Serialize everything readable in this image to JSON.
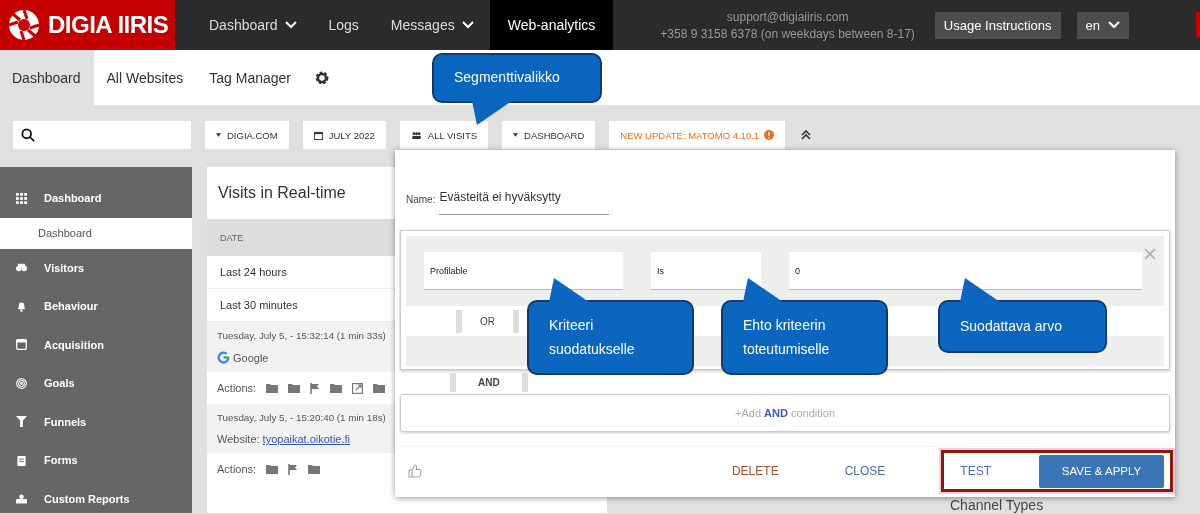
{
  "header": {
    "logo": "DIGIA IIRIS",
    "nav": [
      {
        "label": "Dashboard",
        "dropdown": true,
        "selected": false
      },
      {
        "label": "Logs",
        "dropdown": false,
        "selected": false
      },
      {
        "label": "Messages",
        "dropdown": true,
        "selected": false
      },
      {
        "label": "Web-analytics",
        "dropdown": false,
        "selected": true
      }
    ],
    "support_email": "support@digiaiiris.com",
    "support_phone": "+358 9 3158 6378 (on weekdays between 8-17)",
    "usage_button": "Usage Instructions",
    "language": "en"
  },
  "tabs": [
    {
      "label": "Dashboard",
      "selected": true
    },
    {
      "label": "All Websites",
      "selected": false
    },
    {
      "label": "Tag Manager",
      "selected": false
    }
  ],
  "toolbar": {
    "selectors": [
      {
        "kind": "dropdown",
        "label": "DIGIA.COM"
      },
      {
        "kind": "calendar",
        "label": "JULY 2022"
      },
      {
        "kind": "segment",
        "label": "ALL VISITS"
      },
      {
        "kind": "dropdown",
        "label": "DASHBOARD"
      }
    ],
    "update_notice": "NEW UPDATE: MATOMO 4.10.1"
  },
  "sidebar": [
    {
      "label": "Dashboard",
      "kind": "grid",
      "children": [
        {
          "label": "Dashboard",
          "selected": true
        }
      ]
    },
    {
      "label": "Visitors",
      "kind": "binoculars"
    },
    {
      "label": "Behaviour",
      "kind": "bell"
    },
    {
      "label": "Acquisition",
      "kind": "window"
    },
    {
      "label": "Goals",
      "kind": "target"
    },
    {
      "label": "Funnels",
      "kind": "funnel"
    },
    {
      "label": "Forms",
      "kind": "clipboard"
    },
    {
      "label": "Custom Reports",
      "kind": "report"
    }
  ],
  "realtime": {
    "title": "Visits in Real-time",
    "column": "DATE",
    "periods": [
      "Last 24 hours",
      "Last 30 minutes"
    ],
    "visits": [
      {
        "time": "Tuesday, July 5, - 15:32:14 (1 min 33s)",
        "kind": "search",
        "source": "Google",
        "actions_label": "Actions:",
        "actions": [
          {
            "kind": "folder"
          },
          {
            "kind": "folder"
          },
          {
            "kind": "flag"
          },
          {
            "kind": "folder"
          },
          {
            "kind": "external"
          },
          {
            "kind": "folder"
          }
        ]
      },
      {
        "time": "Tuesday, July 5, - 15:20:40 (1 min 18s)",
        "kind": "website",
        "website_label": "Website:",
        "website": "tyopaikat.oikotie.fi",
        "actions_label": "Actions:",
        "actions": [
          {
            "kind": "folder"
          },
          {
            "kind": "flag"
          },
          {
            "kind": "folder"
          }
        ]
      }
    ]
  },
  "background_heading": "Channel Types",
  "segment_editor": {
    "name_label": "Name:",
    "name_value": "Evästeitä ei hyväksytty",
    "criterion": "Profilable",
    "operator": "Is",
    "value": "0",
    "or_label": "OR",
    "and_label": "AND",
    "add_condition": "+Add **AND** condition",
    "delete": "DELETE",
    "close": "CLOSE",
    "test": "TEST",
    "save": "SAVE & APPLY"
  },
  "callouts": [
    {
      "text": "Segmenttivalikko"
    },
    {
      "text": "Kriteeri suodatukselle"
    },
    {
      "text": "Ehto kriteerin toteutumiselle"
    },
    {
      "text": "Suodattava arvo"
    }
  ]
}
